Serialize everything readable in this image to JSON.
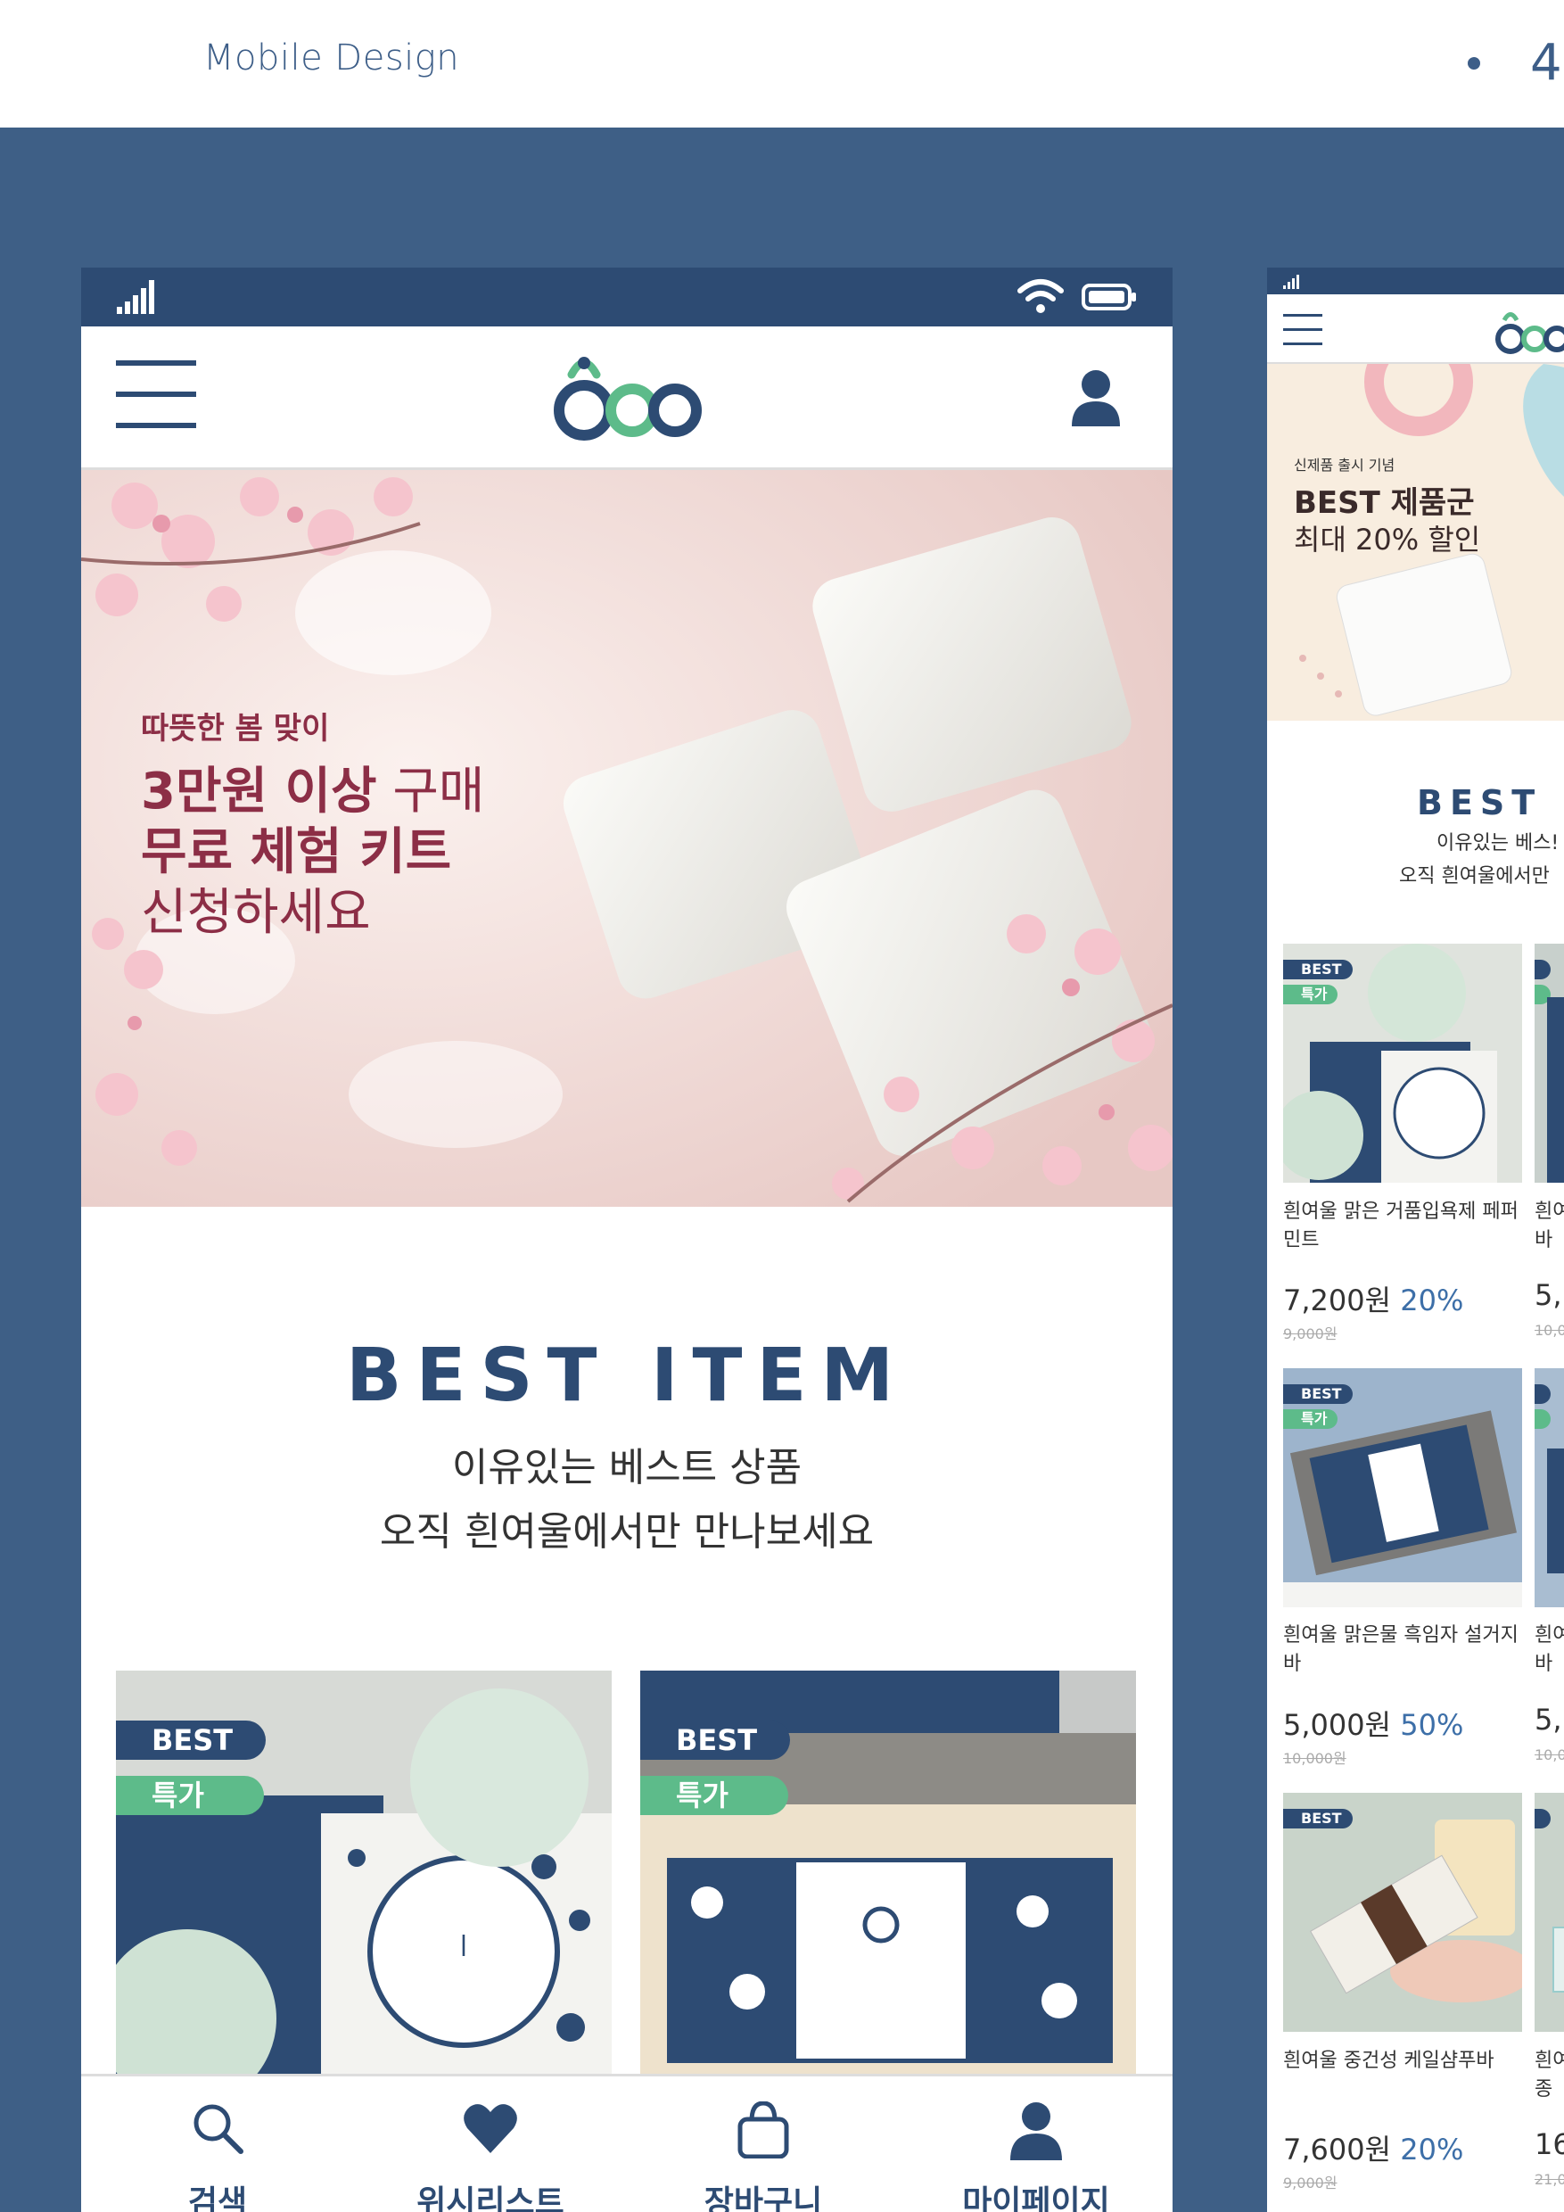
{
  "header": {
    "title": "Mobile Design",
    "page_number": "4"
  },
  "phone1": {
    "banner": {
      "line1": "따뜻한 봄 맞이",
      "line2a": "3만원 이상",
      "line2b": " 구매",
      "line3a": "무료 체험",
      "line3b": " 키트",
      "line4": "신청하세요"
    },
    "best": {
      "title": "BEST ITEM",
      "sub1": "이유있는 베스트 상품",
      "sub2": "오직 흰여울에서만 만나보세요"
    },
    "badges": {
      "best": "BEST",
      "sale": "특가"
    },
    "nav": [
      {
        "label": "검색",
        "icon": "search-icon"
      },
      {
        "label": "위시리스트",
        "icon": "heart-icon"
      },
      {
        "label": "장바구니",
        "icon": "bag-icon"
      },
      {
        "label": "마이페이지",
        "icon": "person-icon"
      }
    ]
  },
  "phone2": {
    "banner": {
      "small": "신제품 출시 기념",
      "title": "BEST 제품군",
      "sub": "최대 20% 할인"
    },
    "best": {
      "title": "BEST IT",
      "sub1": "이유있는 베스!",
      "sub2": "오직 흰여울에서만"
    },
    "badges": {
      "best": "BEST",
      "sale": "특가"
    },
    "products": [
      {
        "name": "흰여울 맑은 거품입욕제 페퍼민트",
        "price": "7,200원",
        "discount": "20%",
        "original": "9,000원"
      },
      {
        "name": "흰여울 맑은물 흑임자 설거지바",
        "price": "5,000원",
        "discount": "50%",
        "original": "10,000원"
      },
      {
        "name": "흰여울 중건성 케일샴푸바",
        "price": "7,600원",
        "discount": "20%",
        "original": "9,000원"
      }
    ],
    "products_col2": [
      {
        "name": "흰여",
        "name2": "바",
        "price": "5,",
        "original": "10,0"
      },
      {
        "name": "흰여",
        "name2": "바",
        "price": "5,",
        "original": "10,0"
      },
      {
        "name": "흰여",
        "name2": "종",
        "price": "16",
        "original": "21,0"
      }
    ]
  },
  "colors": {
    "navy": "#2d4b73",
    "accent_green": "#5dbb8a",
    "background": "#3e5f86",
    "price_accent": "#3d6fa8"
  }
}
